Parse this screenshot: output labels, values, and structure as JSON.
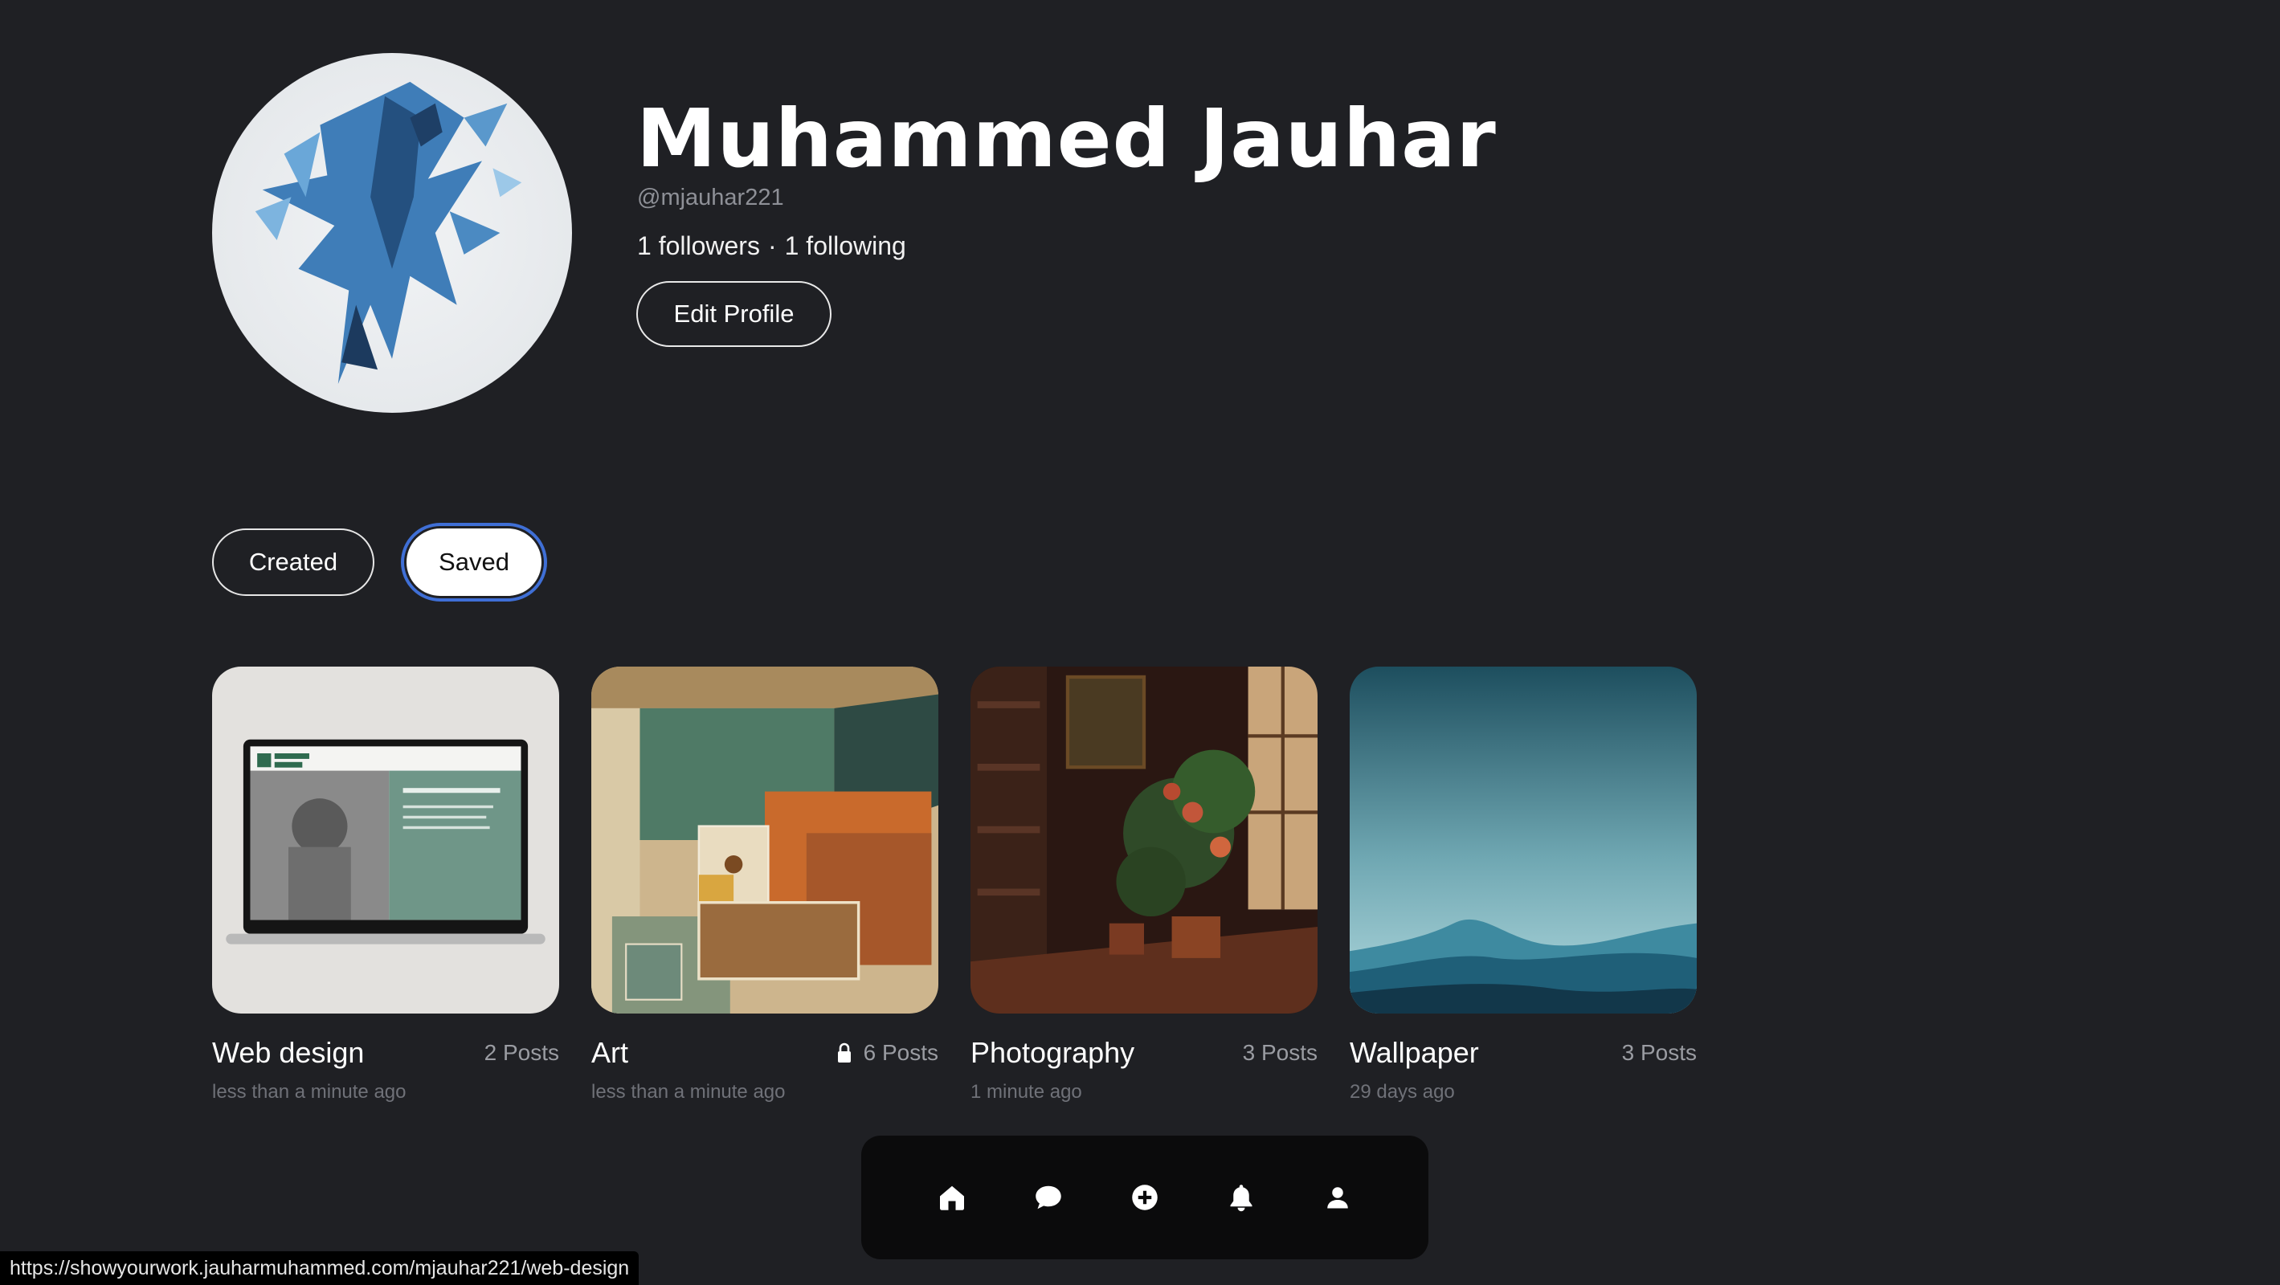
{
  "profile": {
    "name": "Muhammed Jauhar",
    "handle": "@mjauhar221",
    "followers": "1 followers",
    "separator": "·",
    "following": "1 following",
    "edit_label": "Edit Profile",
    "avatar_icon": "profile-avatar"
  },
  "tabs": [
    {
      "label": "Created",
      "selected": false
    },
    {
      "label": "Saved",
      "selected": true
    }
  ],
  "boards": [
    {
      "title": "Web design",
      "count": "2 Posts",
      "time": "less than a minute ago",
      "locked": false
    },
    {
      "title": "Art",
      "count": "6 Posts",
      "time": "less than a minute ago",
      "locked": true
    },
    {
      "title": "Photography",
      "count": "3 Posts",
      "time": "1 minute ago",
      "locked": false
    },
    {
      "title": "Wallpaper",
      "count": "3 Posts",
      "time": "29 days ago",
      "locked": false
    }
  ],
  "nav": [
    {
      "icon": "home-icon"
    },
    {
      "icon": "chat-icon"
    },
    {
      "icon": "plus-circle-icon"
    },
    {
      "icon": "bell-icon"
    },
    {
      "icon": "user-icon"
    }
  ],
  "status_url": "https://showyourwork.jauharmuhammed.com/mjauhar221/web-design",
  "colors": {
    "background": "#1f2024",
    "navbar": "#0b0b0c",
    "focus_ring": "#3f6fd6"
  }
}
